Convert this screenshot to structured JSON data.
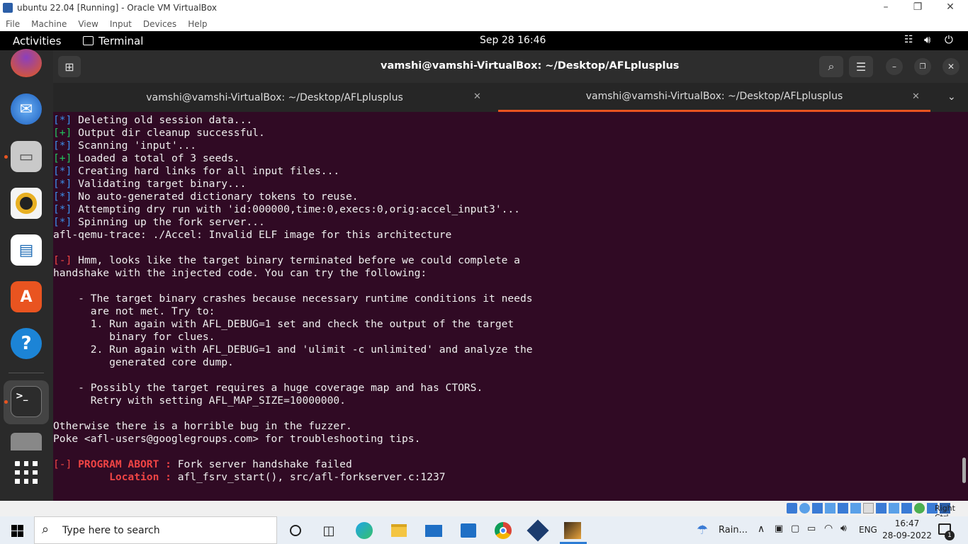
{
  "vbox": {
    "title": "ubuntu 22.04 [Running] - Oracle VM VirtualBox",
    "menu": [
      "File",
      "Machine",
      "View",
      "Input",
      "Devices",
      "Help"
    ],
    "status_right": "Right Ctrl"
  },
  "topbar": {
    "activities": "Activities",
    "app": "Terminal",
    "clock": "Sep 28  16:46"
  },
  "terminal": {
    "title": "vamshi@vamshi-VirtualBox: ~/Desktop/AFLplusplus",
    "tabs": [
      {
        "label": "vamshi@vamshi-VirtualBox: ~/Desktop/AFLplusplus"
      },
      {
        "label": "vamshi@vamshi-VirtualBox: ~/Desktop/AFLplusplus"
      }
    ],
    "lines": [
      {
        "prefix": "[*]",
        "color": "blue",
        "text": " Deleting old session data..."
      },
      {
        "prefix": "[+]",
        "color": "green",
        "text": " Output dir cleanup successful."
      },
      {
        "prefix": "[*]",
        "color": "blue",
        "text": " Scanning 'input'..."
      },
      {
        "prefix": "[+]",
        "color": "green",
        "text": " Loaded a total of 3 seeds."
      },
      {
        "prefix": "[*]",
        "color": "blue",
        "text": " Creating hard links for all input files..."
      },
      {
        "prefix": "[*]",
        "color": "blue",
        "text": " Validating target binary..."
      },
      {
        "prefix": "[*]",
        "color": "blue",
        "text": " No auto-generated dictionary tokens to reuse."
      },
      {
        "prefix": "[*]",
        "color": "blue",
        "text": " Attempting dry run with 'id:000000,time:0,execs:0,orig:accel_input3'..."
      },
      {
        "prefix": "[*]",
        "color": "blue",
        "text": " Spinning up the fork server..."
      },
      {
        "prefix": "",
        "color": "",
        "text": "afl-qemu-trace: ./Accel: Invalid ELF image for this architecture"
      },
      {
        "prefix": "",
        "color": "",
        "text": ""
      },
      {
        "prefix": "[-]",
        "color": "red",
        "text": " Hmm, looks like the target binary terminated before we could complete a"
      },
      {
        "prefix": "",
        "color": "",
        "text": "handshake with the injected code. You can try the following:"
      },
      {
        "prefix": "",
        "color": "",
        "text": ""
      },
      {
        "prefix": "",
        "color": "",
        "text": "    - The target binary crashes because necessary runtime conditions it needs"
      },
      {
        "prefix": "",
        "color": "",
        "text": "      are not met. Try to:"
      },
      {
        "prefix": "",
        "color": "",
        "text": "      1. Run again with AFL_DEBUG=1 set and check the output of the target"
      },
      {
        "prefix": "",
        "color": "",
        "text": "         binary for clues."
      },
      {
        "prefix": "",
        "color": "",
        "text": "      2. Run again with AFL_DEBUG=1 and 'ulimit -c unlimited' and analyze the"
      },
      {
        "prefix": "",
        "color": "",
        "text": "         generated core dump."
      },
      {
        "prefix": "",
        "color": "",
        "text": ""
      },
      {
        "prefix": "",
        "color": "",
        "text": "    - Possibly the target requires a huge coverage map and has CTORS."
      },
      {
        "prefix": "",
        "color": "",
        "text": "      Retry with setting AFL_MAP_SIZE=10000000."
      },
      {
        "prefix": "",
        "color": "",
        "text": ""
      },
      {
        "prefix": "",
        "color": "",
        "text": "Otherwise there is a horrible bug in the fuzzer."
      },
      {
        "prefix": "",
        "color": "",
        "text": "Poke <afl-users@googlegroups.com> for troubleshooting tips."
      },
      {
        "prefix": "",
        "color": "",
        "text": ""
      },
      {
        "prefix": "[-]",
        "color": "red",
        "text": " PROGRAM ABORT : ",
        "tail": "Fork server handshake failed"
      },
      {
        "prefix": "",
        "color": "",
        "text": "         Location : ",
        "tail": "afl_fsrv_start(), src/afl-forkserver.c:1237",
        "redlabel": true
      }
    ]
  },
  "taskbar": {
    "search_placeholder": "Type here to search",
    "weather": "Rain...",
    "lang": "ENG",
    "time": "16:47",
    "date": "28-09-2022",
    "notif_count": "1"
  }
}
